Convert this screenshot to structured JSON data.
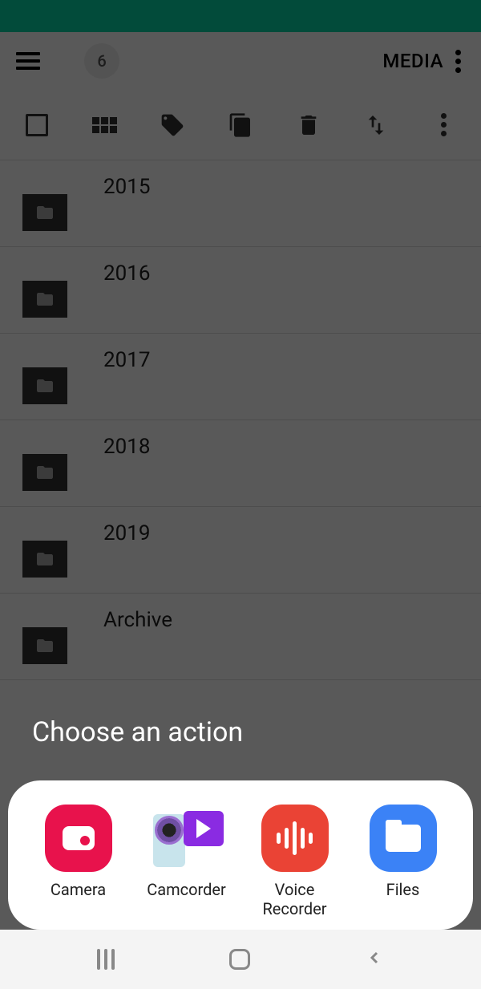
{
  "status_bar": {},
  "top_bar": {
    "count": "6",
    "media_label": "MEDIA"
  },
  "folders": [
    {
      "name": "2015"
    },
    {
      "name": "2016"
    },
    {
      "name": "2017"
    },
    {
      "name": "2018"
    },
    {
      "name": "2019"
    },
    {
      "name": "Archive"
    }
  ],
  "sheet": {
    "title": "Choose an action",
    "actions": [
      {
        "label": "Camera"
      },
      {
        "label": "Camcorder"
      },
      {
        "label": "Voice Recorder"
      },
      {
        "label": "Files"
      }
    ]
  }
}
